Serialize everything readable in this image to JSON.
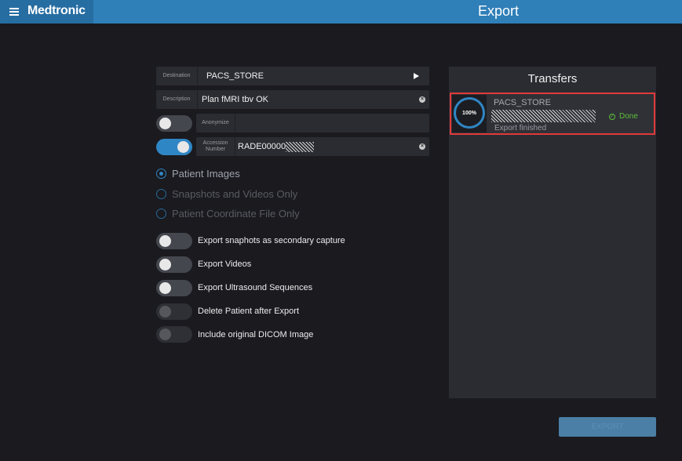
{
  "header": {
    "brand": "Medtronic",
    "title": "Export"
  },
  "form": {
    "destination": {
      "label": "Destination",
      "value": "PACS_STORE"
    },
    "description": {
      "label": "Description",
      "value": "Plan fMRI tbv OK"
    },
    "anonymize": {
      "label": "Anonymize",
      "value": "",
      "enabled": false
    },
    "accession": {
      "label": "Accession Number",
      "value": "RADE00000",
      "enabled": true
    }
  },
  "radios": [
    {
      "label": "Patient Images",
      "selected": true
    },
    {
      "label": "Snapshots and Videos Only",
      "selected": false
    },
    {
      "label": "Patient Coordinate File Only",
      "selected": false
    }
  ],
  "options": [
    {
      "label": "Export snaphots as secondary capture",
      "enabled": false
    },
    {
      "label": "Export Videos",
      "enabled": false
    },
    {
      "label": "Export Ultrasound Sequences",
      "enabled": false
    },
    {
      "label": "Delete Patient after Export",
      "enabled": false
    },
    {
      "label": "Include original DICOM Image",
      "enabled": false
    }
  ],
  "transfers": {
    "title": "Transfers",
    "items": [
      {
        "destination": "PACS_STORE",
        "progress": "100%",
        "status": "Export finished",
        "result": "Done"
      }
    ]
  },
  "export_button": "EXPORT",
  "colors": {
    "accent": "#2f86c4",
    "header": "#2f7fb8",
    "success": "#5fbf3a",
    "highlight": "#e03a3a"
  }
}
